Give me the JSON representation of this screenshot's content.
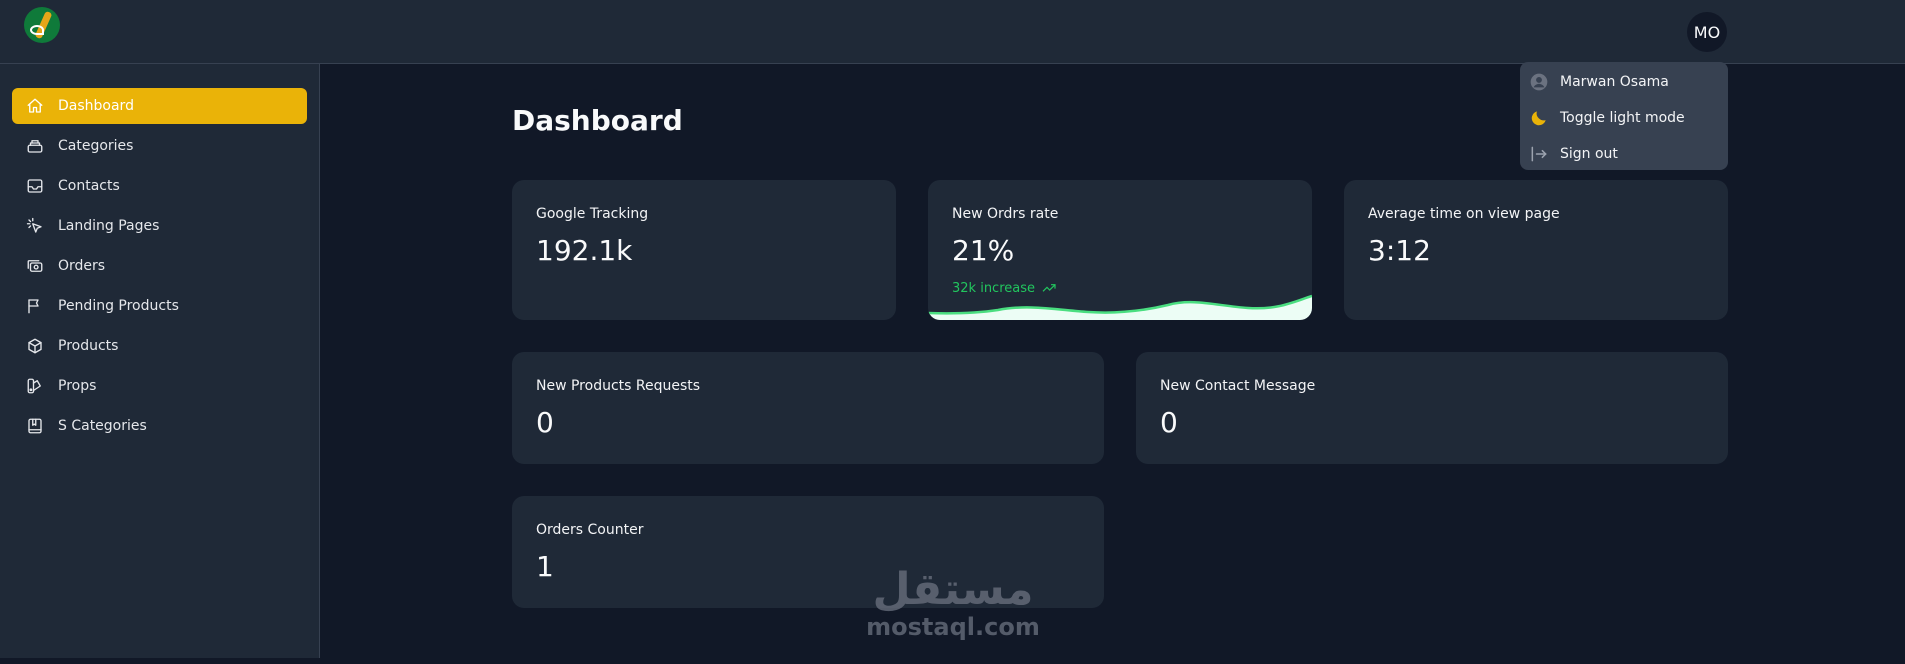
{
  "header": {
    "avatar_initials": "MO"
  },
  "user_menu": {
    "items": [
      {
        "label": "Marwan Osama",
        "icon": "user-circle-icon"
      },
      {
        "label": "Toggle light mode",
        "icon": "moon-icon"
      },
      {
        "label": "Sign out",
        "icon": "sign-out-icon"
      }
    ]
  },
  "sidebar": {
    "items": [
      {
        "label": "Dashboard",
        "icon": "home-icon",
        "active": true
      },
      {
        "label": "Categories",
        "icon": "layers-icon"
      },
      {
        "label": "Contacts",
        "icon": "inbox-icon"
      },
      {
        "label": "Landing Pages",
        "icon": "cursor-click-icon"
      },
      {
        "label": "Orders",
        "icon": "cash-icon"
      },
      {
        "label": "Pending Products",
        "icon": "flag-icon"
      },
      {
        "label": "Products",
        "icon": "cube-icon"
      },
      {
        "label": "Props",
        "icon": "swatch-icon"
      },
      {
        "label": "S Categories",
        "icon": "book-icon"
      }
    ]
  },
  "main": {
    "title": "Dashboard",
    "cards": {
      "google_tracking": {
        "label": "Google Tracking",
        "value": "192.1k"
      },
      "new_orders_rate": {
        "label": "New Ordrs rate",
        "value": "21%",
        "increase": "32k increase"
      },
      "avg_time": {
        "label": "Average time on view page",
        "value": "3:12"
      },
      "new_products_requests": {
        "label": "New Products Requests",
        "value": "0"
      },
      "new_contact_message": {
        "label": "New Contact Message",
        "value": "0"
      },
      "orders_counter": {
        "label": "Orders Counter",
        "value": "1"
      }
    }
  },
  "watermark": {
    "arabic": "مستقل",
    "latin": "mostaql.com"
  },
  "colors": {
    "accent": "#eab308",
    "background": "#111827",
    "surface": "#1f2937",
    "success": "#22c55e"
  }
}
